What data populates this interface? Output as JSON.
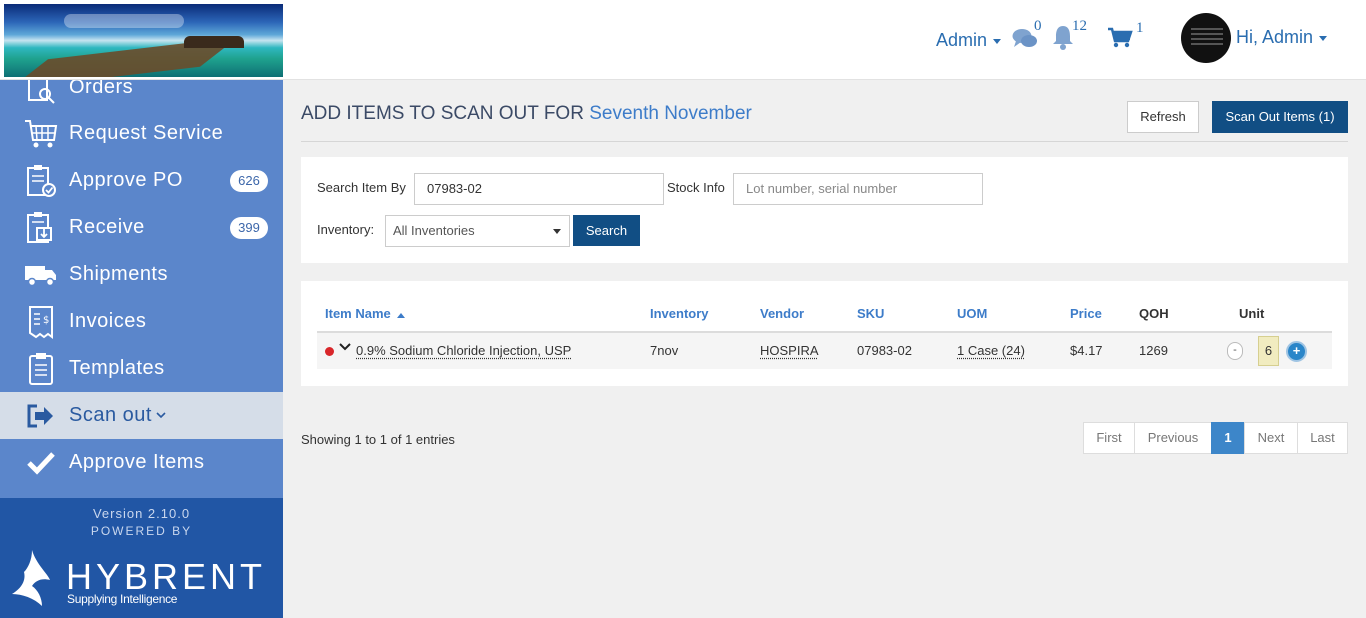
{
  "header": {
    "admin_menu_label": "Admin",
    "messages_count": "0",
    "notifications_count": "12",
    "cart_count": "1",
    "user_greeting": "Hi, Admin"
  },
  "sidebar": {
    "items": [
      {
        "label": "Orders",
        "icon": "orders-search-icon"
      },
      {
        "label": "Request Service",
        "icon": "cart-grid-icon"
      },
      {
        "label": "Approve PO",
        "icon": "clipboard-check-icon",
        "badge": "626"
      },
      {
        "label": "Receive",
        "icon": "clipboard-download-icon",
        "badge": "399"
      },
      {
        "label": "Shipments",
        "icon": "truck-icon"
      },
      {
        "label": "Invoices",
        "icon": "invoice-icon"
      },
      {
        "label": "Templates",
        "icon": "clipboard-list-icon"
      },
      {
        "label": "Scan out",
        "icon": "sign-out-icon",
        "active": true
      },
      {
        "label": "Approve Items",
        "icon": "checkmark-icon"
      }
    ],
    "version": "Version 2.10.0",
    "powered_by": "POWERED BY",
    "brand": "HYBRENT",
    "tagline": "Supplying Intelligence"
  },
  "page": {
    "title_prefix": "ADD ITEMS TO SCAN OUT FOR",
    "title_highlight": "Seventh November",
    "refresh_label": "Refresh",
    "scan_out_label": "Scan Out Items (1)"
  },
  "search": {
    "search_by_label": "Search Item By",
    "search_value": "07983-02",
    "stock_info_label": "Stock Info",
    "stock_info_placeholder": "Lot number, serial number",
    "inventory_label": "Inventory:",
    "inventory_selected": "All Inventories",
    "search_button": "Search"
  },
  "table": {
    "columns": [
      "Item Name",
      "Inventory",
      "Vendor",
      "SKU",
      "UOM",
      "Price",
      "QOH",
      "Unit"
    ],
    "rows": [
      {
        "item_name": "0.9% Sodium Chloride Injection, USP",
        "inventory": "7nov",
        "vendor": "HOSPIRA",
        "sku": "07983-02",
        "uom": "1 Case (24)",
        "price": "$4.17",
        "qoh": "1269",
        "unit": "6"
      }
    ]
  },
  "pagination": {
    "showing": "Showing 1 to 1 of 1 entries",
    "first": "First",
    "previous": "Previous",
    "current": "1",
    "next": "Next",
    "last": "Last"
  },
  "colors": {
    "sidebar": "#5b86cb",
    "sidebar_footer": "#2156a5",
    "primary_button": "#114e84",
    "link": "#3d7cc9",
    "status_dot": "#d9262a"
  }
}
